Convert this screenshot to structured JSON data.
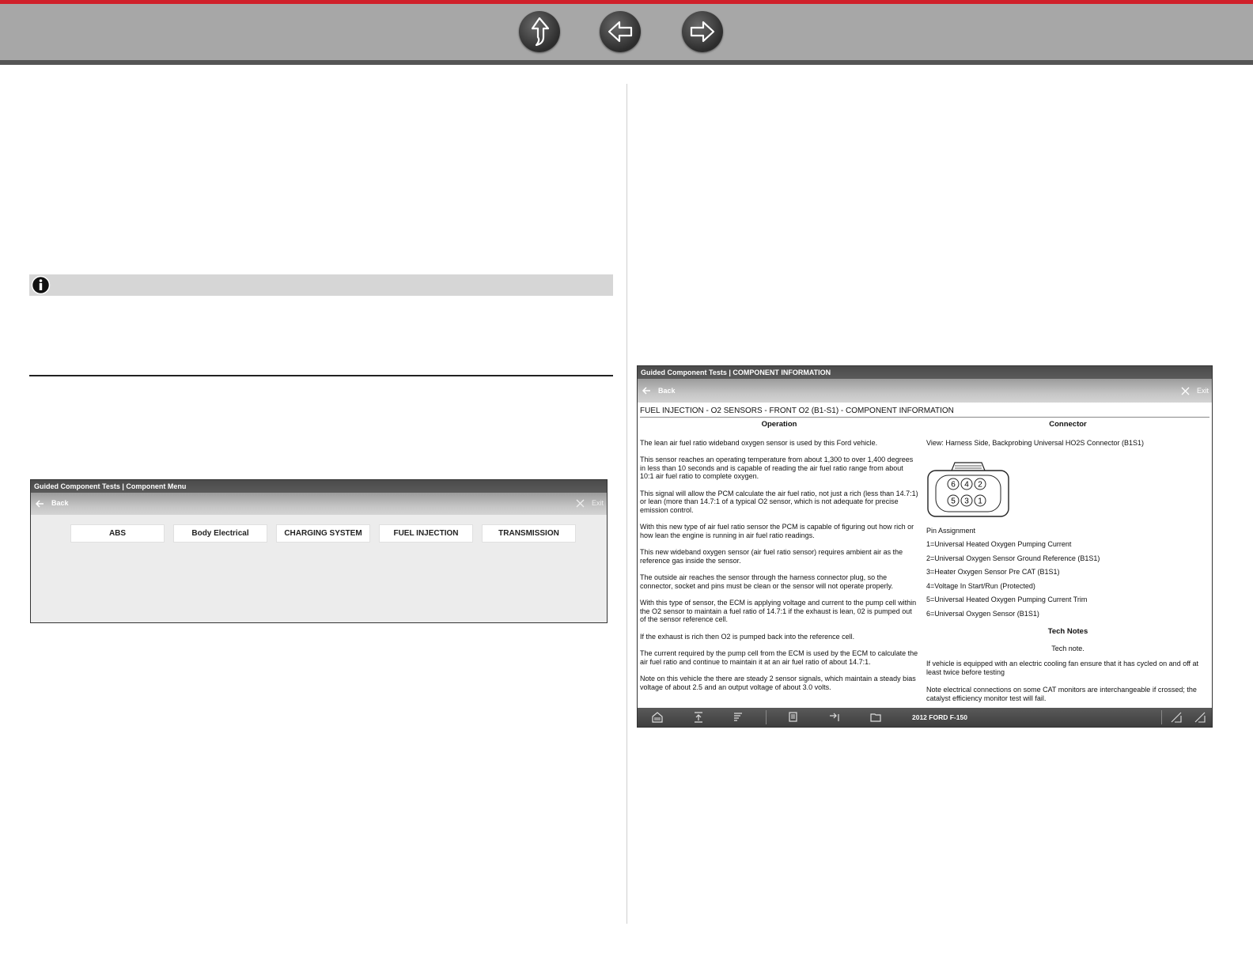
{
  "colors": {
    "accent_red": "#d0202a",
    "topbar_gray": "#a7a7a7",
    "nav_button": "#3a3a3a"
  },
  "nav": {
    "up_icon": "up-arrow-icon",
    "back_icon": "left-arrow-icon",
    "forward_icon": "right-arrow-icon"
  },
  "screen1": {
    "title": "Guided Component Tests | Component Menu",
    "back_label": "Back",
    "exit_label": "Exit",
    "menu_items": [
      "ABS",
      "Body Electrical",
      "CHARGING SYSTEM",
      "FUEL INJECTION",
      "TRANSMISSION"
    ]
  },
  "screen2": {
    "title": "Guided Component Tests | COMPONENT INFORMATION",
    "back_label": "Back",
    "exit_label": "Exit",
    "heading": "FUEL INJECTION - O2 SENSORS - FRONT O2 (B1-S1) - COMPONENT INFORMATION",
    "operation_header": "Operation",
    "connector_header": "Connector",
    "operation_paragraphs": [
      "The lean air fuel ratio wideband oxygen sensor is used by this Ford vehicle.",
      "This sensor reaches an operating temperature from about 1,300 to over 1,400 degrees in less than 10 seconds and is capable of reading the air fuel ratio range from about 10:1 air fuel ratio to complete oxygen.",
      "This signal will allow the PCM calculate the air fuel ratio, not just a rich (less than 14.7:1) or lean (more than 14.7:1 of a typical O2 sensor, which is not adequate for precise emission control.",
      "With this new type of air fuel ratio sensor the PCM is capable of figuring out how rich or how lean the engine is running in air fuel ratio readings.",
      "This new wideband oxygen sensor (air fuel ratio sensor) requires ambient air as the reference gas inside the sensor.",
      "The outside air reaches the sensor through the harness connector plug, so the connector, socket and pins must be clean or the sensor will not operate properly.",
      "With this type of sensor, the ECM is applying voltage and current to the pump cell within the O2 sensor to maintain a fuel ratio of 14.7:1 if the exhaust is lean, 02 is pumped out of the sensor reference cell.",
      "If the exhaust is rich then O2 is pumped back into the reference cell.",
      "The current required by the pump cell from the ECM is used by the ECM to calculate the air fuel ratio and continue to maintain it at an air fuel ratio of about 14.7:1.",
      "Note on this vehicle the there are steady 2 sensor signals, which maintain a steady bias voltage of about 2.5 and an output voltage of about 3.0 volts."
    ],
    "connector_view": "View: Harness Side, Backprobing Universal HO2S Connector (B1S1)",
    "connector_pins_top": [
      "6",
      "4",
      "2"
    ],
    "connector_pins_bottom": [
      "5",
      "3",
      "1"
    ],
    "pin_assignment_label": "Pin Assignment",
    "pins": [
      "1=Universal Heated Oxygen Pumping Current",
      "2=Universal Oxygen Sensor Ground Reference (B1S1)",
      "3=Heater Oxygen Sensor Pre CAT (B1S1)",
      "4=Voltage In Start/Run (Protected)",
      "5=Universal Heated Oxygen Pumping Current Trim",
      "6=Universal Oxygen Sensor (B1S1)"
    ],
    "tech_notes_header": "Tech Notes",
    "tech_note_label": "Tech note.",
    "tech_notes": [
      "If vehicle is equipped with an electric cooling fan ensure that it has cycled on and off at least twice before testing",
      "Note electrical connections on some CAT monitors are interchangeable if crossed; the catalyst efficiency monitor test will fail."
    ],
    "vehicle": "2012 FORD F-150"
  }
}
